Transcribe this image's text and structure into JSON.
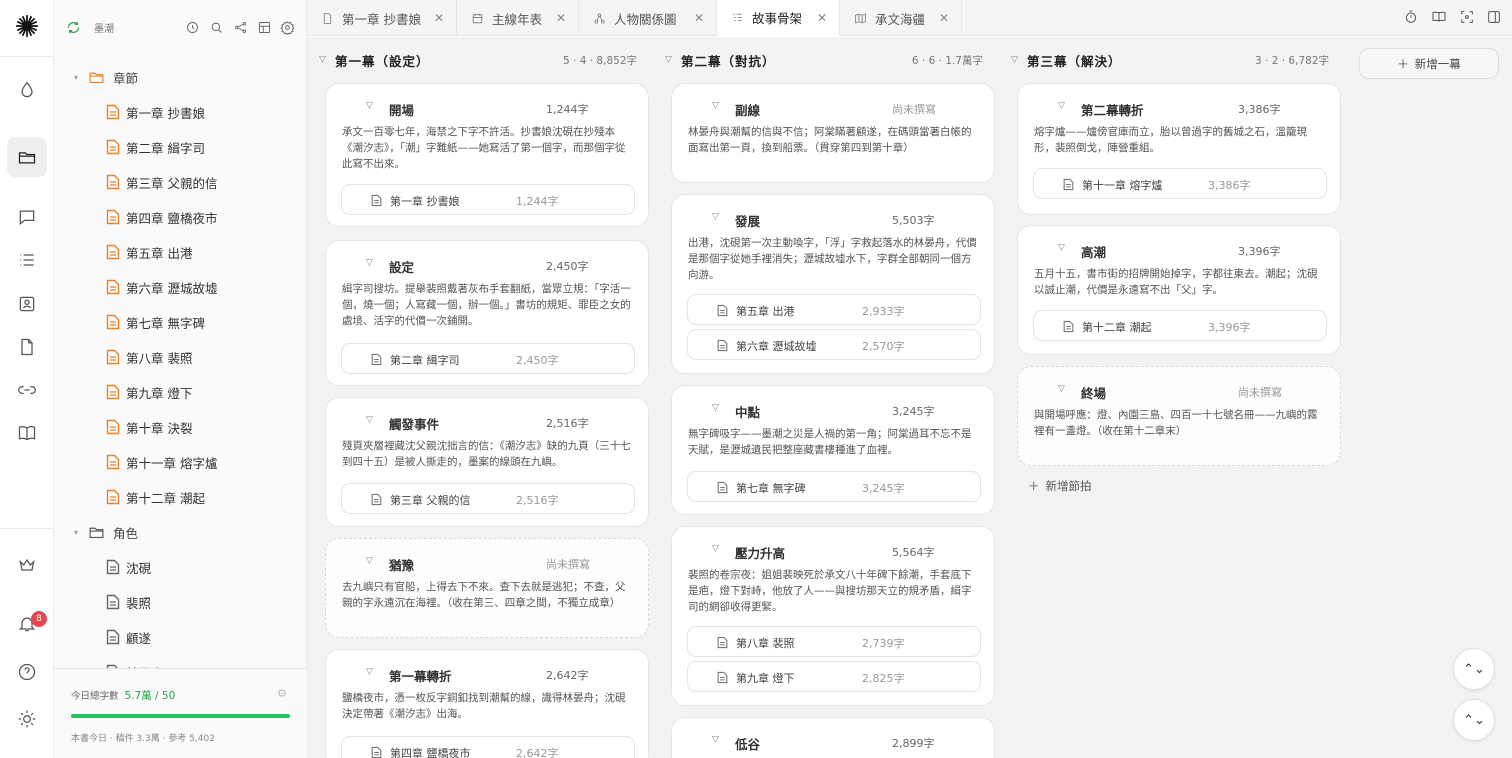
{
  "sidebar": {
    "project_name": "墨潮",
    "folders": [
      {
        "label": "章節"
      },
      {
        "label": "角色"
      }
    ],
    "chapters": [
      "第一章 抄書娘",
      "第二章 緝字司",
      "第三章 父親的信",
      "第四章 鹽橋夜市",
      "第五章 出港",
      "第六章 瀝城故墟",
      "第七章 無字碑",
      "第八章 裴照",
      "第九章 燈下",
      "第十章 決裂",
      "第十一章 熔字爐",
      "第十二章 潮起"
    ],
    "characters": [
      "沈硯",
      "裴照",
      "顧遂",
      "林晏舟"
    ],
    "footer": {
      "today_label": "今日總字數",
      "today_value": "5.7萬 / 50",
      "progress": 1.0,
      "summary": "本書今日 · 稿件 3.3萬 · 參考 5,402"
    },
    "notification_count": "8"
  },
  "tabs": [
    {
      "label": "第一章 抄書娘",
      "icon": "document-icon"
    },
    {
      "label": "主線年表",
      "icon": "calendar-icon"
    },
    {
      "label": "人物關係圖",
      "icon": "graph-icon"
    },
    {
      "label": "故事骨架",
      "icon": "outline-icon",
      "active": true
    },
    {
      "label": "承文海疆",
      "icon": "map-icon"
    }
  ],
  "board": {
    "add_act_label": "新增一幕",
    "add_scene_label": "新增節拍",
    "columns": [
      {
        "title": "第一幕（設定）",
        "meta": "5 · 4 · 8,852字",
        "cards": [
          {
            "name": "開場",
            "words": "1,244字",
            "desc": "承文一百零七年，海禁之下字不許活。抄書娘沈硯在抄殘本《潮汐志》，「潮」字難紙——她寫活了第一個字，而那個字從此寫不出來。",
            "chips": [
              {
                "name": "第一章 抄書娘",
                "words": "1,244字"
              }
            ]
          },
          {
            "name": "設定",
            "words": "2,450字",
            "desc": "緝字司搜坊。提舉裴照戴著灰布手套翻紙，當眾立規：「字活一個，燒一個；人寫藏一個，辦一個。」書坊的規矩、罪臣之女的處境、活字的代價一次鋪開。",
            "chips": [
              {
                "name": "第二章 緝字司",
                "words": "2,450字"
              }
            ]
          },
          {
            "name": "觸發事件",
            "words": "2,516字",
            "desc": "殘頁夾層裡藏沈父親沈拙言的信：《潮汐志》缺的九頁（三十七到四十五）是被人撕走的，墨案的線頭在九嶼。",
            "chips": [
              {
                "name": "第三章 父親的信",
                "words": "2,516字"
              }
            ]
          },
          {
            "name": "猶豫",
            "words": "尚未撰寫",
            "pending": true,
            "dashed": true,
            "desc": "去九嶼只有官船，上得去下不來。查下去就是逃犯；不查，父親的字永遠沉在海裡。（收在第三、四章之間，不獨立成章）",
            "chips": []
          },
          {
            "name": "第一幕轉折",
            "words": "2,642字",
            "desc": "鹽橋夜市，憑一枚反字銅釦找到潮幫的線，識得林晏舟；沈硯決定帶著《潮汐志》出海。",
            "chips": [
              {
                "name": "第四章 鹽橋夜市",
                "words": "2,642字"
              }
            ]
          }
        ]
      },
      {
        "title": "第二幕（對抗）",
        "meta": "6 · 6 · 1.7萬字",
        "cards": [
          {
            "name": "副線",
            "words": "尚未撰寫",
            "pending": true,
            "desc": "林晏舟與潮幫的信與不信；阿棠瞞著顧遂，在碼頭當著白帳的面寫出第一頁，換到船票。（貫穿第四到第十章）",
            "chips": []
          },
          {
            "name": "發展",
            "words": "5,503字",
            "desc": "出港，沈硯第一次主動喚字，「浮」字救起落水的林晏舟，代價是那個字從她手裡消失；瀝城故墟水下，字群全部朝同一個方向游。",
            "chips": [
              {
                "name": "第五章 出港",
                "words": "2,933字"
              },
              {
                "name": "第六章 瀝城故墟",
                "words": "2,570字"
              }
            ]
          },
          {
            "name": "中點",
            "words": "3,245字",
            "desc": "無字碑吸字——墨潮之災是人禍的第一角；阿棠過耳不忘不是天賦，是瀝城遺民把整座藏書樓種進了血裡。",
            "chips": [
              {
                "name": "第七章 無字碑",
                "words": "3,245字"
              }
            ]
          },
          {
            "name": "壓力升高",
            "words": "5,564字",
            "desc": "裴照的卷宗夜：姐姐裴映死於承文八十年碑下餘潮，手套底下是疤，燈下對峙，他放了人——與搜坊那天立的規矛盾，緝字司的網卻收得更緊。",
            "chips": [
              {
                "name": "第八章 裴照",
                "words": "2,739字"
              },
              {
                "name": "第九章 燈下",
                "words": "2,825字"
              }
            ]
          },
          {
            "name": "低谷",
            "words": "2,899字",
            "desc": "",
            "chips": []
          }
        ]
      },
      {
        "title": "第三幕（解決）",
        "meta": "3 · 2 · 6,782字",
        "cards": [
          {
            "name": "第二幕轉折",
            "words": "3,386字",
            "desc": "熔字爐——爐傍官庫而立，胎以曾過字的舊城之石，溫籠現形，裴照倒戈，陣營重組。",
            "chips": [
              {
                "name": "第十一章 熔字爐",
                "words": "3,386字"
              }
            ]
          },
          {
            "name": "高潮",
            "words": "3,396字",
            "desc": "五月十五，書市街的招牌開始掉字，字都往東去。潮起；沈硯以誠止潮，代價是永遠寫不出「父」字。",
            "chips": [
              {
                "name": "第十二章 潮起",
                "words": "3,396字"
              }
            ]
          },
          {
            "name": "終場",
            "words": "尚未撰寫",
            "pending": true,
            "dashed": true,
            "desc": "與開場呼應：燈、內園三島、四百一十七號名冊——九嶼的霧裡有一盞燈。（收在第十二章末）",
            "chips": []
          }
        ]
      }
    ]
  }
}
